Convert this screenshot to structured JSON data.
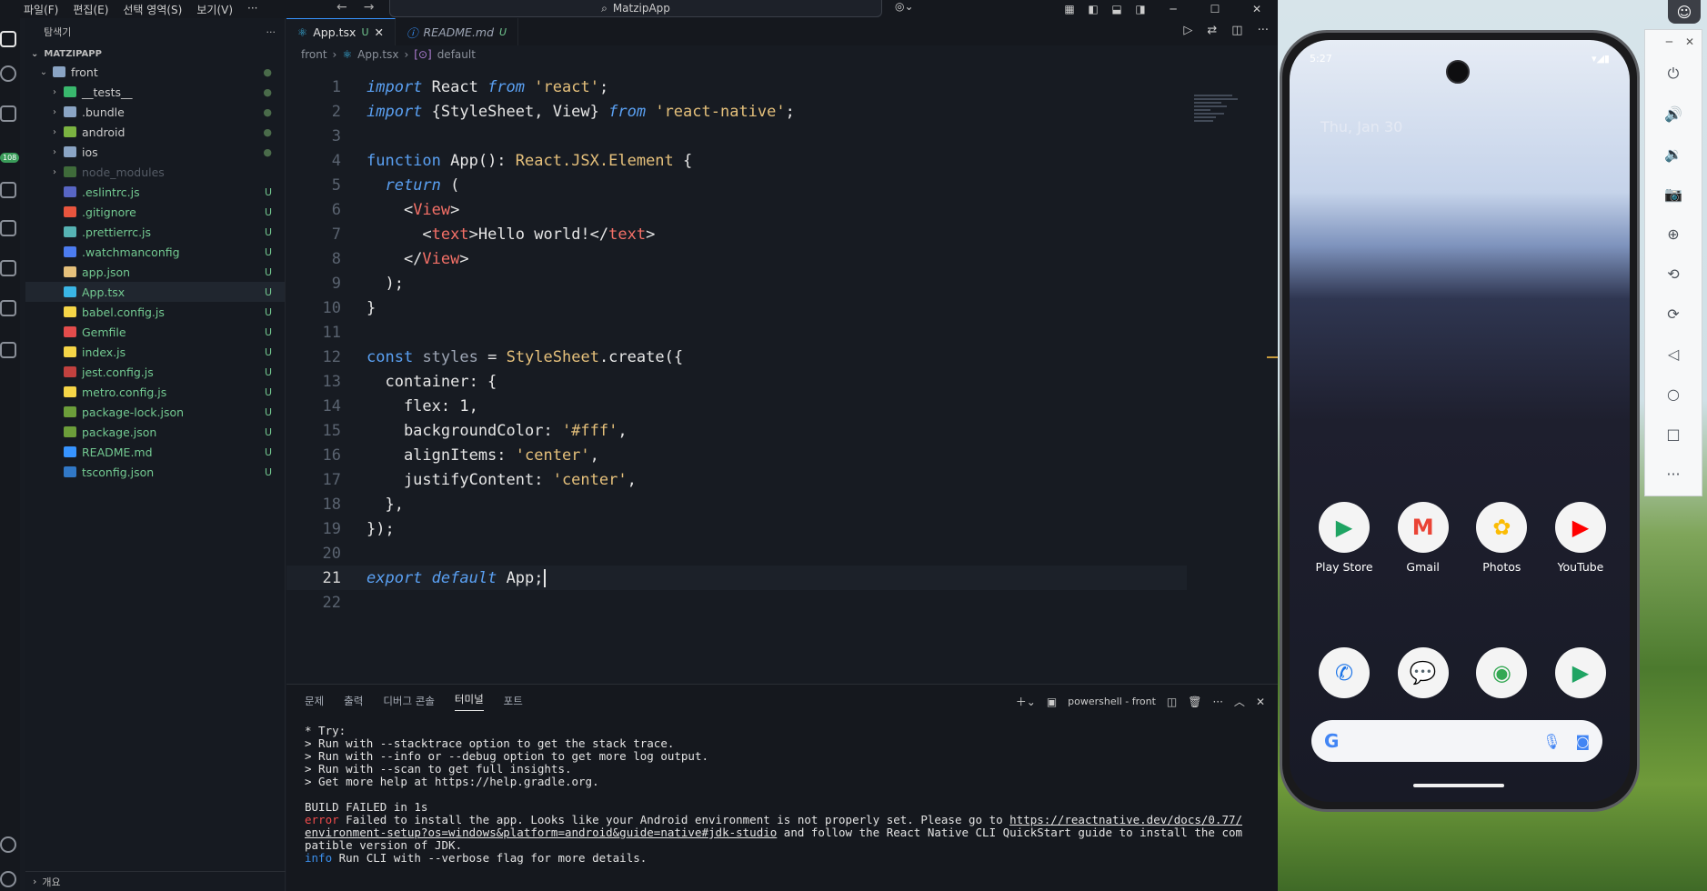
{
  "vscode": {
    "menu": [
      "파일(F)",
      "편집(E)",
      "선택 영역(S)",
      "보기(V)",
      "···"
    ],
    "command_center": "MatzipApp",
    "explorer": {
      "title": "탐색기",
      "project": "MATZIPAPP",
      "items": [
        {
          "label": "front",
          "kind": "folder-open",
          "status": "●",
          "color": "#cccccc",
          "icon_color": "#8aa4c4"
        },
        {
          "label": "__tests__",
          "kind": "folder",
          "status": "●",
          "color": "#cccccc",
          "icon_color": "#39b86d"
        },
        {
          "label": ".bundle",
          "kind": "folder",
          "status": "●",
          "color": "#cccccc",
          "icon_color": "#8aa4c4"
        },
        {
          "label": "android",
          "kind": "folder",
          "status": "●",
          "color": "#cccccc",
          "icon_color": "#7bb341"
        },
        {
          "label": "ios",
          "kind": "folder",
          "status": "●",
          "color": "#cccccc",
          "icon_color": "#8aa4c4"
        },
        {
          "label": "node_modules",
          "kind": "folder",
          "status": "",
          "color": "#555c66",
          "icon_color": "#3f6b3a"
        },
        {
          "label": ".eslintrc.js",
          "kind": "file",
          "status": "U",
          "color": "#73c991",
          "icon_color": "#5866c4"
        },
        {
          "label": ".gitignore",
          "kind": "file",
          "status": "U",
          "color": "#73c991",
          "icon_color": "#e8553e"
        },
        {
          "label": ".prettierrc.js",
          "kind": "file",
          "status": "U",
          "color": "#73c991",
          "icon_color": "#56b3b4"
        },
        {
          "label": ".watchmanconfig",
          "kind": "file",
          "status": "U",
          "color": "#73c991",
          "icon_color": "#4c7cf0"
        },
        {
          "label": "app.json",
          "kind": "file",
          "status": "U",
          "color": "#73c991",
          "icon_color": "#e5c07b"
        },
        {
          "label": "App.tsx",
          "kind": "file",
          "status": "U",
          "color": "#73c991",
          "icon_color": "#3ab6e6"
        },
        {
          "label": "babel.config.js",
          "kind": "file",
          "status": "U",
          "color": "#73c991",
          "icon_color": "#f5d547"
        },
        {
          "label": "Gemfile",
          "kind": "file",
          "status": "U",
          "color": "#73c991",
          "icon_color": "#e34c4c"
        },
        {
          "label": "index.js",
          "kind": "file",
          "status": "U",
          "color": "#73c991",
          "icon_color": "#f5d547"
        },
        {
          "label": "jest.config.js",
          "kind": "file",
          "status": "U",
          "color": "#73c991",
          "icon_color": "#c2413f"
        },
        {
          "label": "metro.config.js",
          "kind": "file",
          "status": "U",
          "color": "#73c991",
          "icon_color": "#f5d547"
        },
        {
          "label": "package-lock.json",
          "kind": "file",
          "status": "U",
          "color": "#73c991",
          "icon_color": "#6c9e3a"
        },
        {
          "label": "package.json",
          "kind": "file",
          "status": "U",
          "color": "#73c991",
          "icon_color": "#6c9e3a"
        },
        {
          "label": "README.md",
          "kind": "file",
          "status": "U",
          "color": "#73c991",
          "icon_color": "#3794ff"
        },
        {
          "label": "tsconfig.json",
          "kind": "file",
          "status": "U",
          "color": "#73c991",
          "icon_color": "#3178c6"
        }
      ],
      "outline": "개요"
    },
    "activity_badge": "108",
    "tabs": [
      {
        "label": "App.tsx",
        "mod": "U",
        "active": true
      },
      {
        "label": "README.md",
        "mod": "U",
        "active": false
      }
    ],
    "breadcrumb": [
      "front",
      "App.tsx",
      "default"
    ],
    "code_lines": [
      "import React from 'react';",
      "import {StyleSheet, View} from 'react-native';",
      "",
      "function App(): React.JSX.Element {",
      "  return (",
      "    <View>",
      "      <text>Hello world!</text>",
      "    </View>",
      "  );",
      "}",
      "",
      "const styles = StyleSheet.create({",
      "  container: {",
      "    flex: 1,",
      "    backgroundColor: '#fff',",
      "    alignItems: 'center',",
      "    justifyContent: 'center',",
      "  },",
      "});",
      "",
      "export default App;",
      ""
    ],
    "current_line": 21,
    "panel": {
      "tabs": [
        "문제",
        "출력",
        "디버그 콘솔",
        "터미널",
        "포트"
      ],
      "active_tab": "터미널",
      "terminal_name": "powershell - front",
      "terminal_lines": [
        {
          "t": "* Try:",
          "c": ""
        },
        {
          "t": "> Run with --stacktrace option to get the stack trace.",
          "c": ""
        },
        {
          "t": "> Run with --info or --debug option to get more log output.",
          "c": ""
        },
        {
          "t": "> Run with --scan to get full insights.",
          "c": ""
        },
        {
          "t": "> Get more help at https://help.gradle.org.",
          "c": ""
        },
        {
          "t": "",
          "c": ""
        },
        {
          "t": "BUILD FAILED in 1s",
          "c": ""
        },
        {
          "t": "error Failed to install the app. Looks like your Android environment is not properly set. Please go to https://reactnative.dev/docs/0.77/",
          "c": "err"
        },
        {
          "t": "environment-setup?os=windows&platform=android&guide=native#jdk-studio and follow the React Native CLI QuickStart guide to install the com",
          "c": "link"
        },
        {
          "t": "patible version of JDK.",
          "c": ""
        },
        {
          "t": "info Run CLI with --verbose flag for more details.",
          "c": "info"
        }
      ]
    }
  },
  "phone": {
    "status_time": "5:27",
    "date": "Thu, Jan 30",
    "apps_row1": [
      {
        "label": "Play Store",
        "glyph": "▶",
        "color": "#1fa463"
      },
      {
        "label": "Gmail",
        "glyph": "M",
        "color": "#ea4335"
      },
      {
        "label": "Photos",
        "glyph": "✿",
        "color": "#fbbc04"
      },
      {
        "label": "YouTube",
        "glyph": "▶",
        "color": "#ff0000"
      }
    ],
    "apps_row2": [
      {
        "glyph": "✆",
        "color": "#1a73e8"
      },
      {
        "glyph": "💬",
        "color": "#1a73e8"
      },
      {
        "glyph": "◉",
        "color": "#34a853"
      },
      {
        "glyph": "▶",
        "color": "#1fa463"
      }
    ],
    "search_logo": "G"
  },
  "emulator_toolbar": [
    "power-icon",
    "volume-up-icon",
    "volume-down-icon",
    "camera-icon",
    "zoom-icon",
    "rotate-left-icon",
    "rotate-right-icon",
    "back-icon",
    "home-icon",
    "overview-icon",
    "more-icon"
  ]
}
